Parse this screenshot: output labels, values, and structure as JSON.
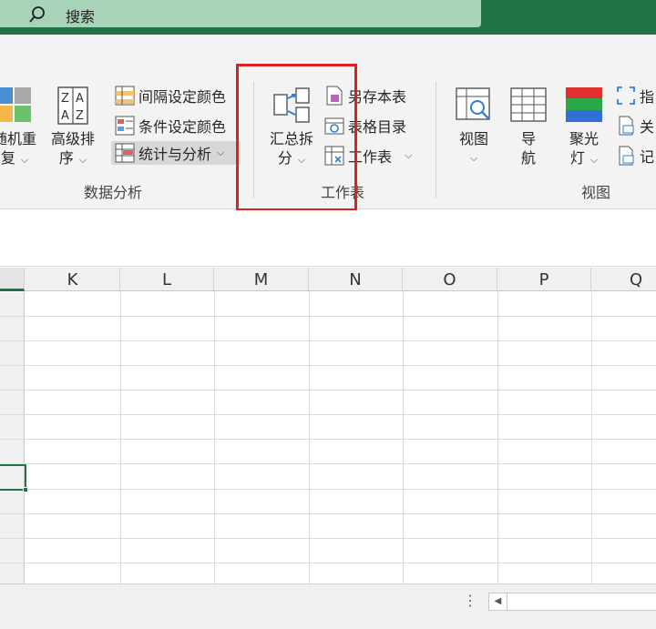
{
  "search": {
    "label": "搜索"
  },
  "ribbon": {
    "data_analysis": {
      "random_repeat": [
        "随机重",
        "复"
      ],
      "advanced_sort": [
        "高级排",
        "序"
      ],
      "interval_color": "间隔设定颜色",
      "conditional_color": "条件设定颜色",
      "stats_analysis": "统计与分析",
      "group_label": "数据分析"
    },
    "worksheet": {
      "summary_split": [
        "汇总拆",
        "分"
      ],
      "save_as": "另存本表",
      "table_catalog": "表格目录",
      "worksheet_menu": "工作表",
      "group_label": "工作表"
    },
    "view": {
      "view_btn": "视图",
      "nav_btn": [
        "导",
        "航"
      ],
      "spotlight_btn": [
        "聚光",
        "灯"
      ],
      "pointer_partial": "指",
      "close_partial": "关",
      "note_partial": "记",
      "group_label": "视图"
    }
  },
  "grid": {
    "columns": [
      "K",
      "L",
      "M",
      "N",
      "O",
      "P",
      "Q"
    ]
  },
  "colors": {
    "accent": "#217346",
    "highlight_box": "#e02020"
  }
}
